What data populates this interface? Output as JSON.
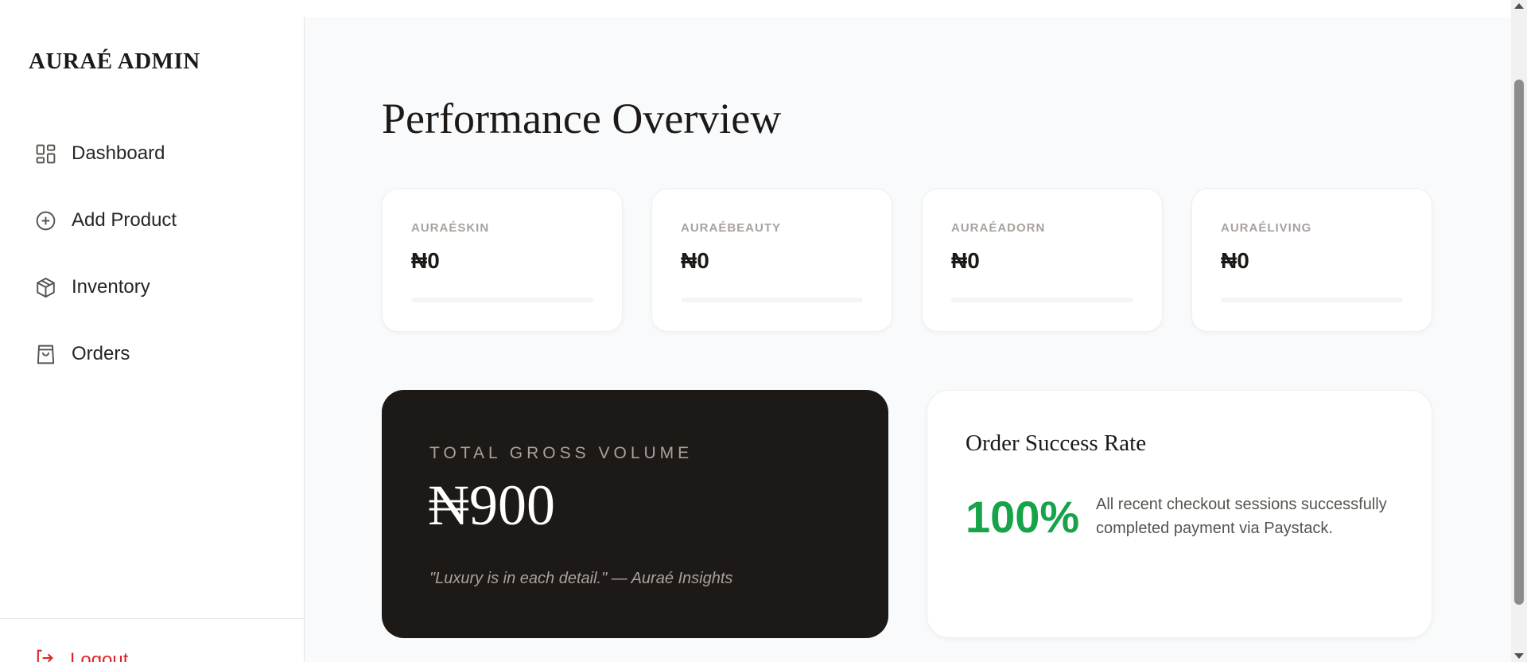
{
  "sidebar": {
    "brand": "AURAÉ ADMIN",
    "items": [
      {
        "label": "Dashboard",
        "icon": "dashboard-icon"
      },
      {
        "label": "Add Product",
        "icon": "plus-circle-icon"
      },
      {
        "label": "Inventory",
        "icon": "box-icon"
      },
      {
        "label": "Orders",
        "icon": "shopping-bag-icon"
      }
    ],
    "logout_label": "Logout"
  },
  "main": {
    "title": "Performance Overview",
    "stats": [
      {
        "name": "AURAÉSKIN",
        "value": "₦0",
        "progress": 0
      },
      {
        "name": "AURAÉBEAUTY",
        "value": "₦0",
        "progress": 0
      },
      {
        "name": "AURAÉADORN",
        "value": "₦0",
        "progress": 0
      },
      {
        "name": "AURAÉLIVING",
        "value": "₦0",
        "progress": 0
      }
    ],
    "gross": {
      "label": "TOTAL GROSS VOLUME",
      "amount": "₦900",
      "quote": "\"Luxury is in each detail.\" — Auraé Insights"
    },
    "success": {
      "title": "Order Success Rate",
      "rate": "100%",
      "description": "All recent checkout sessions successfully completed payment via Paystack."
    }
  },
  "colors": {
    "dark": "#1c1917",
    "success": "#16a34a",
    "danger": "#dc2626",
    "muted": "#a8a29e"
  }
}
